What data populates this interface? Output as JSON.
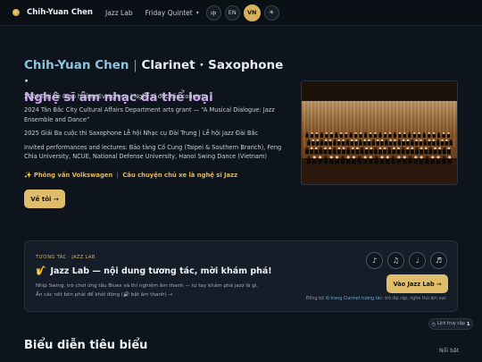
{
  "nav": {
    "brand": "Chih-Yuan Chen",
    "links": [
      "Jazz Lab",
      "Friday Quintet"
    ],
    "caret": "▾",
    "languages": [
      "中",
      "EN",
      "VN"
    ],
    "active_language": "VN",
    "theme_icon": "☀"
  },
  "hero": {
    "name": "Chih-Yuan Chen",
    "sep": "|",
    "role": "Clarinet · Saxophone ·",
    "genre": "Nghệ sĩ âm nhạc đa thể loại",
    "facts": [
      "2024 Trại hè Giao hưởng Evergreen | Nghệ sĩ độc tấu concerto",
      "2024 Tân Bắc City Cultural Affairs Department arts grant — “A Musical Dialogue: Jazz Ensemble and Dance”",
      "2025 Giải Ba cuộc thi Saxophone Lễ hội Nhạc cụ Đài Trung | Lễ hội Jazz Đài Bắc",
      "Invited performances and lectures: Bảo tàng Cố Cung (Taipei & Southern Branch), Feng Chia University, NCUE, National Defense University, Hanoi Swing Dance (Vietnam)"
    ],
    "featured_icon": "✨",
    "featured_a": "Phỏng vấn Volkswagen",
    "featured_sep": "|",
    "featured_b": "Câu chuyện chủ xe là nghệ sĩ Jazz",
    "about_button": "Về tôi →",
    "photo_alt": "Orchestra on stage"
  },
  "lab": {
    "tag": "TƯƠNG TÁC · JAZZ LAB",
    "title_icon": "🎷",
    "title": "Jazz Lab — nội dung tương tác, mời khám phá!",
    "desc_1": "Nhịp Swing, trò chơi ứng tấu Blues và thí nghiệm âm thanh — tự tay khám phá jazz là gì.",
    "desc_2": "Ấn các nốt bên phải để khởi động (🔊 bật âm thanh) →",
    "icons": [
      "♪",
      "♫",
      "♩",
      "♬"
    ],
    "button": "Vào Jazz Lab →",
    "hint_a": "Đồng bộ ",
    "hint_b": "lộ trang Clarinet tương tác",
    "hint_c": ": trò lắp ráp, nghe thử âm vực"
  },
  "recent": {
    "label": "Lịch truy cập",
    "count": "1"
  },
  "section": {
    "title": "Biểu diễn tiêu biểu",
    "link": "Nổi bật"
  },
  "colors": {
    "accent": "#e0bd6b",
    "background": "#0e141c",
    "name_blue": "#8ec3de",
    "genre_purple": "#c7a7e7"
  }
}
